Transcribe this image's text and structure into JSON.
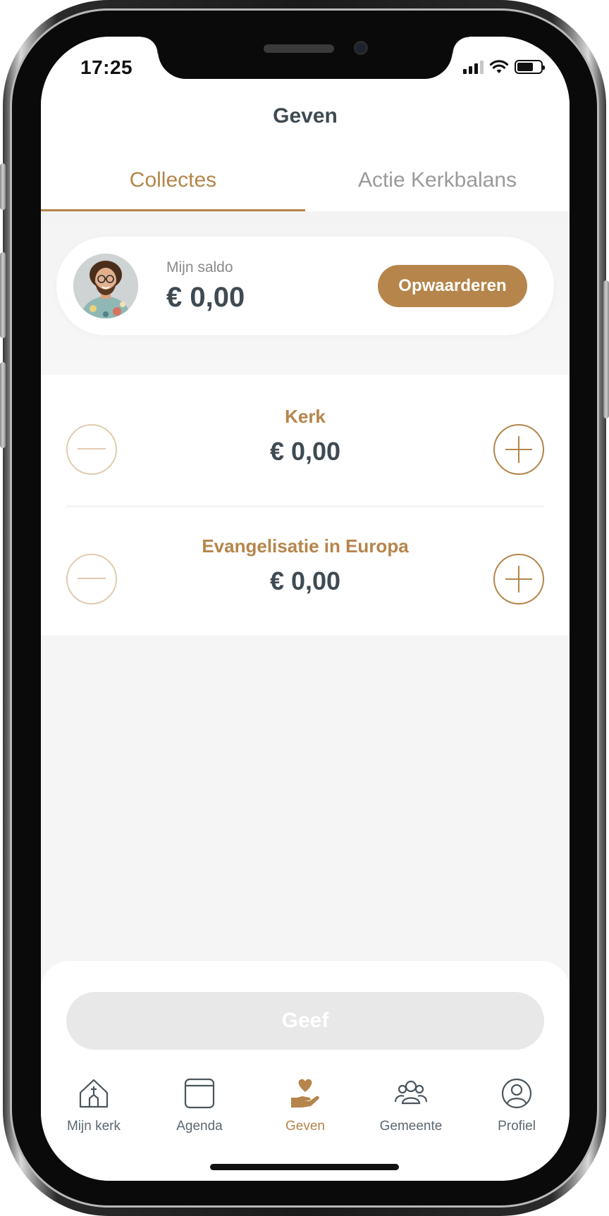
{
  "status_bar": {
    "time": "17:25"
  },
  "header": {
    "title": "Geven"
  },
  "tabs": [
    {
      "label": "Collectes",
      "active": true
    },
    {
      "label": "Actie Kerkbalans",
      "active": false
    }
  ],
  "saldo": {
    "label": "Mijn saldo",
    "amount": "€ 0,00",
    "topup_label": "Opwaarderen"
  },
  "collectes": [
    {
      "name": "Kerk",
      "amount": "€ 0,00"
    },
    {
      "name": "Evangelisatie in Europa",
      "amount": "€ 0,00"
    }
  ],
  "give_button": {
    "label": "Geef"
  },
  "bottom_nav": [
    {
      "label": "Mijn kerk",
      "icon": "church-icon",
      "active": false
    },
    {
      "label": "Agenda",
      "icon": "calendar-icon",
      "active": false
    },
    {
      "label": "Geven",
      "icon": "giving-hand-heart-icon",
      "active": true
    },
    {
      "label": "Gemeente",
      "icon": "community-group-icon",
      "active": false
    },
    {
      "label": "Profiel",
      "icon": "profile-icon",
      "active": false
    }
  ],
  "colors": {
    "accent": "#b5854b",
    "accent_light": "#e3cbb0",
    "text_dark": "#3f4a52",
    "text_muted": "#9a9a9a",
    "background": "#f5f5f5",
    "disabled_button": "#e8e8e8"
  }
}
